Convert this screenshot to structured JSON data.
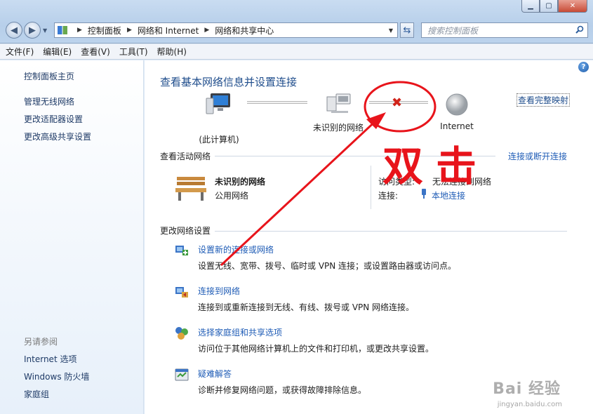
{
  "window": {
    "min_glyph": "▁",
    "max_glyph": "▢",
    "close_glyph": "✕"
  },
  "address": {
    "crumbs": [
      "控制面板",
      "网络和 Internet",
      "网络和共享中心"
    ]
  },
  "search": {
    "placeholder": "搜索控制面板"
  },
  "menu": [
    "文件(F)",
    "编辑(E)",
    "查看(V)",
    "工具(T)",
    "帮助(H)"
  ],
  "sidebar": {
    "home": "控制面板主页",
    "links": [
      "管理无线网络",
      "更改适配器设置",
      "更改高级共享设置"
    ],
    "see_also_label": "另请参阅",
    "see_also": [
      "Internet 选项",
      "Windows 防火墙",
      "家庭组"
    ]
  },
  "main": {
    "title": "查看基本网络信息并设置连接",
    "view_full_map": "查看完整映射",
    "map": {
      "computer": "(此计算机)",
      "network": "未识别的网络",
      "internet": "Internet"
    },
    "active_head": "查看活动网络",
    "connect_disconnect": "连接或断开连接",
    "active": {
      "name": "未识别的网络",
      "type": "公用网络",
      "access_label": "访问类型:",
      "access_value": "无法连接到网络",
      "conn_label": "连接:",
      "conn_value": "本地连接"
    },
    "change_head": "更改网络设置",
    "tasks": [
      {
        "icon": "new-connection-icon",
        "title": "设置新的连接或网络",
        "desc": "设置无线、宽带、拨号、临时或 VPN 连接；或设置路由器或访问点。"
      },
      {
        "icon": "connect-network-icon",
        "title": "连接到网络",
        "desc": "连接到或重新连接到无线、有线、拨号或 VPN 网络连接。"
      },
      {
        "icon": "homegroup-icon",
        "title": "选择家庭组和共享选项",
        "desc": "访问位于其他网络计算机上的文件和打印机，或更改共享设置。"
      },
      {
        "icon": "troubleshoot-icon",
        "title": "疑难解答",
        "desc": "诊断并修复网络问题，或获得故障排除信息。"
      }
    ]
  },
  "annotation": {
    "text": "双击",
    "color": "#e8141b"
  },
  "watermark": {
    "brand": "Bai 经验",
    "url": "jingyan.baidu.com"
  }
}
